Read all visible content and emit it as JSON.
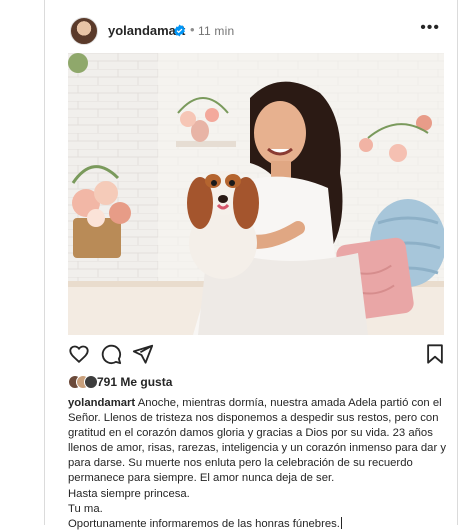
{
  "post": {
    "username": "yolandamart",
    "time": "11 min",
    "dot": "•",
    "more": "•••"
  },
  "photo": {
    "subject": "woman-with-dog-photo"
  },
  "actions": {
    "like": "heart-icon",
    "comment": "comment-icon",
    "share": "share-icon",
    "save": "bookmark-icon"
  },
  "likes": {
    "text": "791 Me gusta"
  },
  "caption": {
    "username": "yolandamart",
    "lines": [
      "Anoche, mientras dormía, nuestra amada Adela partió con el Señor. Llenos de tristeza nos disponemos a despedir sus restos, pero con gratitud en el corazón damos gloria y gracias a Dios por su vida. 23 años llenos de amor, risas, rarezas, inteligencia y un corazón inmenso para dar y para darse. Su muerte nos enluta pero la celebración de su recuerdo permanece para siempre. El amor nunca deja de ser.",
      "Hasta siempre princesa.",
      "Tu ma.",
      "Oportunamente informaremos de las honras fúnebres."
    ]
  },
  "colors": {
    "verified": "#0095f6",
    "text": "#262626",
    "muted": "#737373"
  }
}
